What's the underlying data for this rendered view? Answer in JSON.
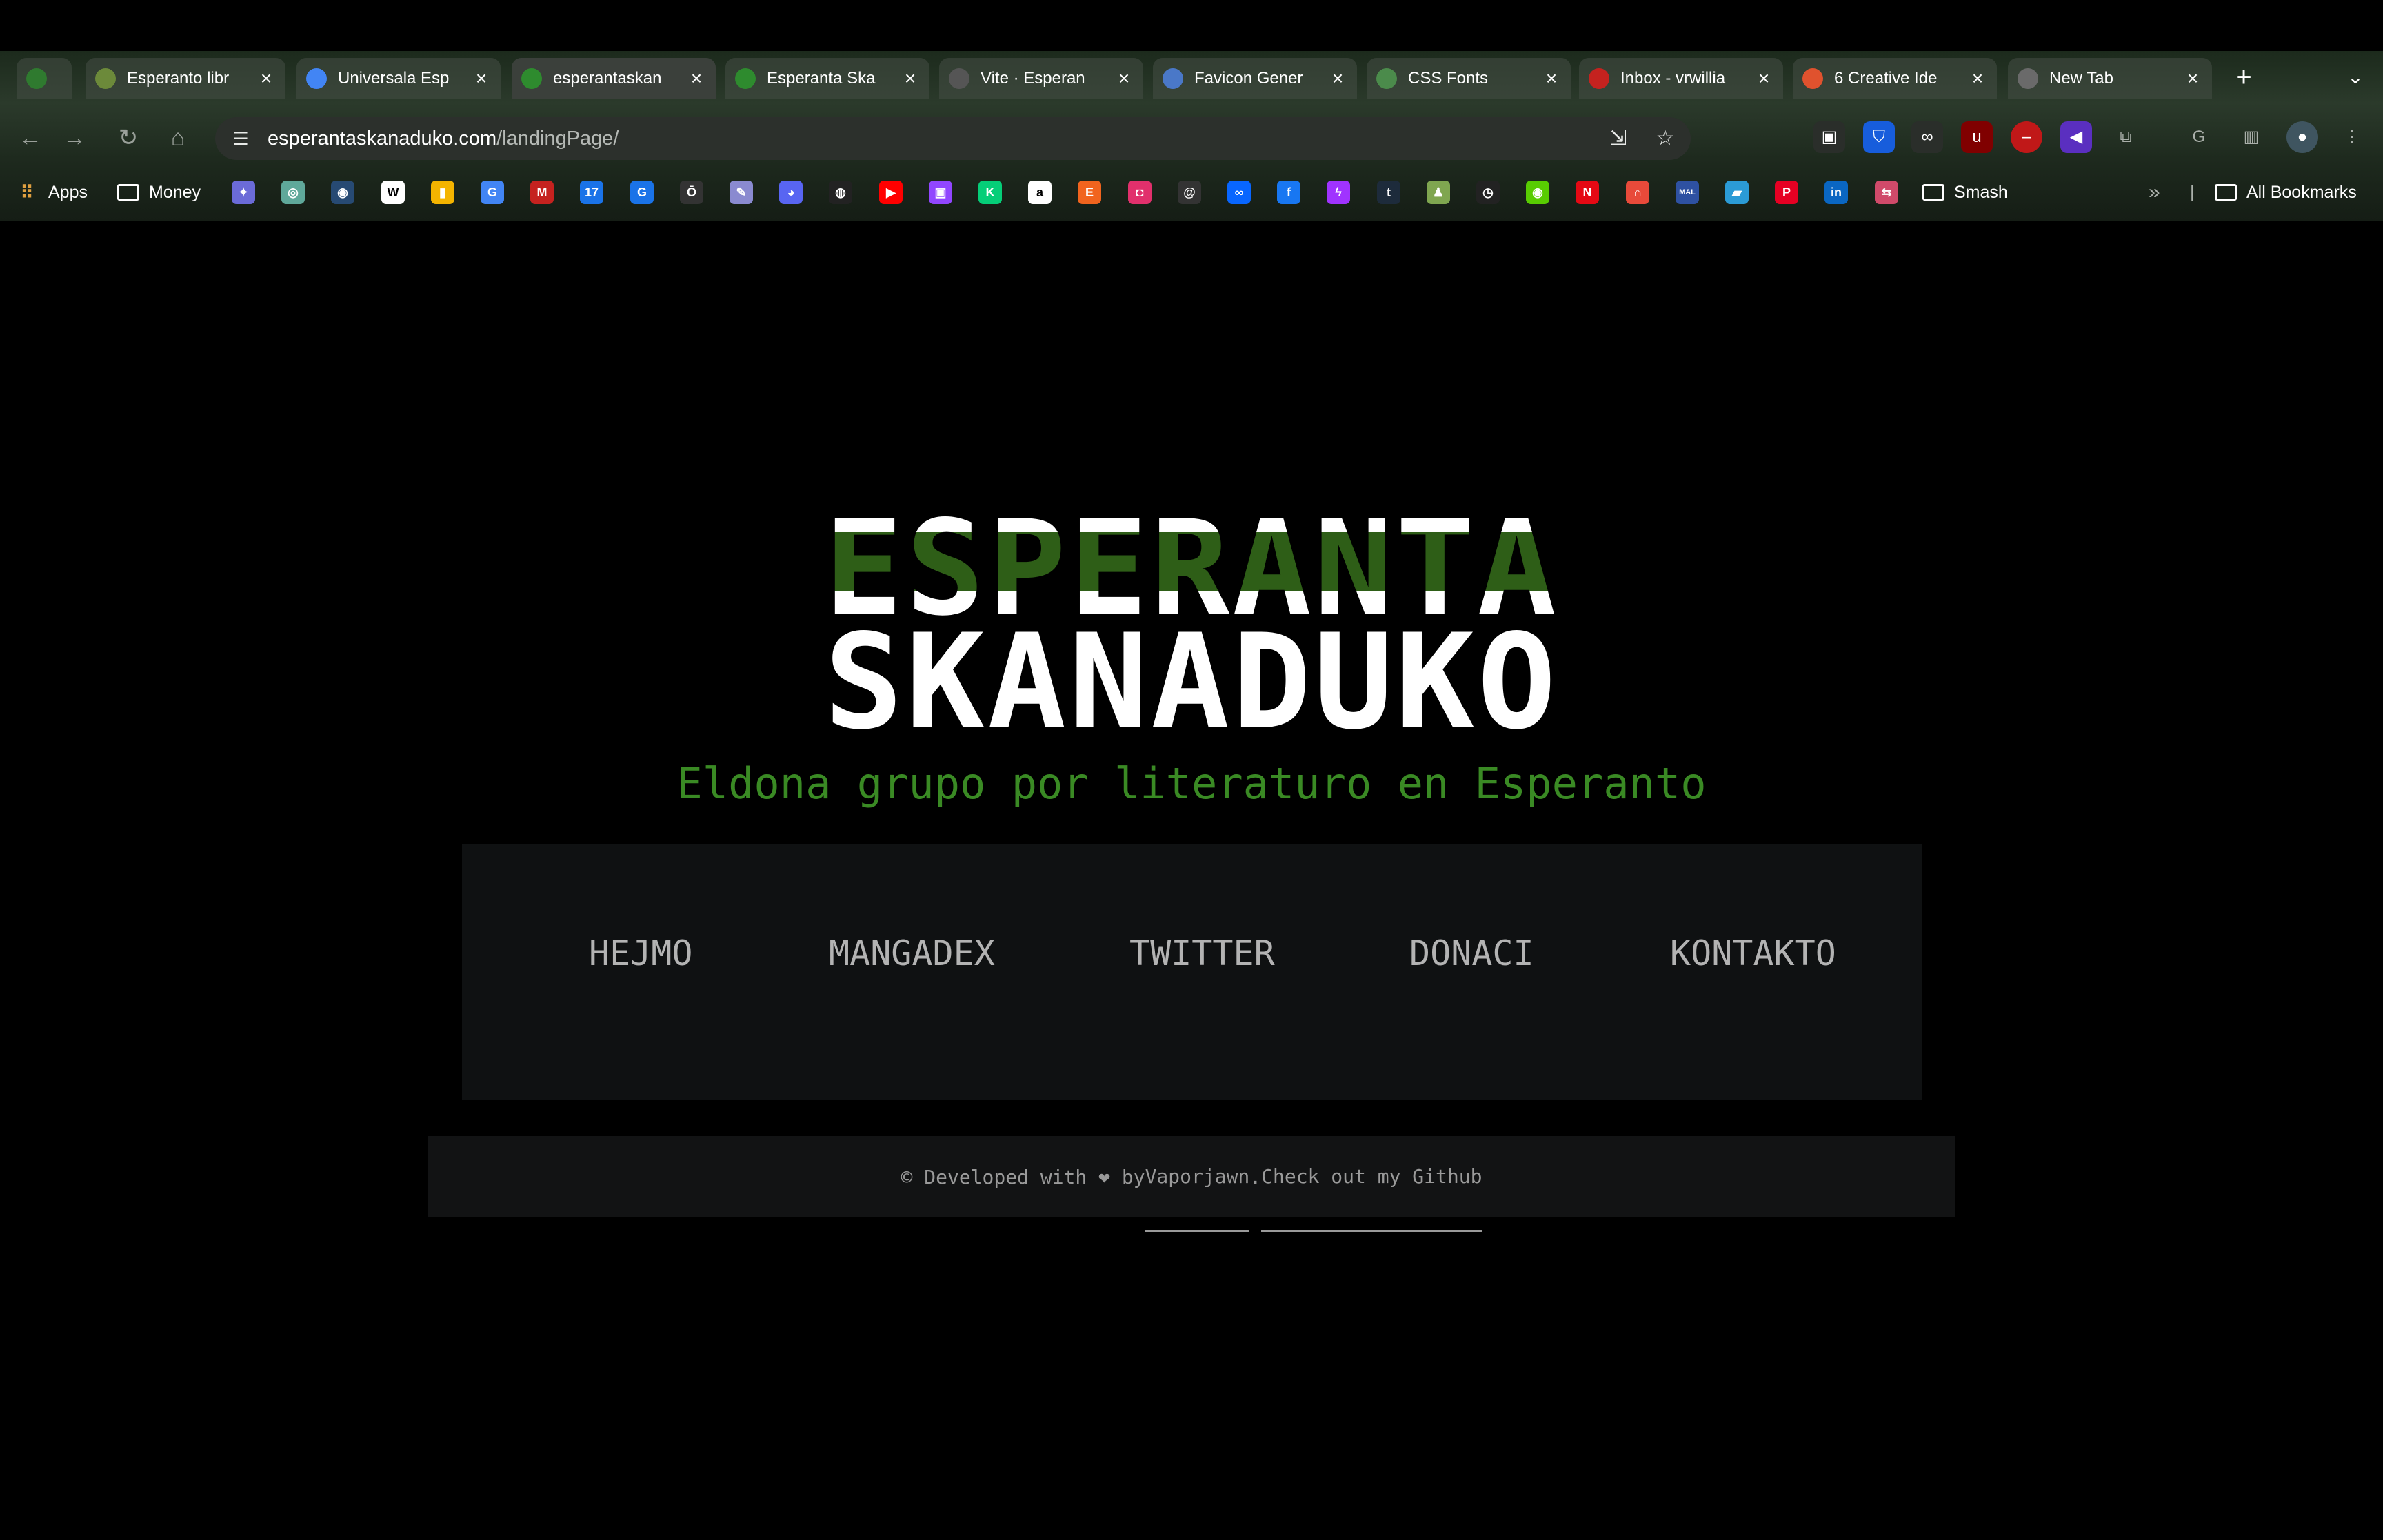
{
  "browser": {
    "tabs": [
      {
        "label": "",
        "icon": "grid-favicon-icon",
        "color": "#2f7a2f"
      },
      {
        "label": "Esperanto libr",
        "icon": "circle-favicon-icon",
        "color": "#6c8a3a"
      },
      {
        "label": "Universala Esp",
        "icon": "google-favicon-icon",
        "color": "#4285f4"
      },
      {
        "label": "esperantaskan",
        "icon": "esperanto-flag-icon",
        "color": "#2e8b2e"
      },
      {
        "label": "Esperanta Ska",
        "icon": "esperanto-flag-icon",
        "color": "#2e8b2e"
      },
      {
        "label": "Vite · Esperan",
        "icon": "github-favicon-icon",
        "color": "#555"
      },
      {
        "label": "Favicon Gener",
        "icon": "favicon-gen-icon",
        "color": "#4a78c8"
      },
      {
        "label": "CSS Fonts",
        "icon": "globe-favicon-icon",
        "color": "#4b8b4b"
      },
      {
        "label": "Inbox - vrwillia",
        "icon": "gmail-favicon-icon",
        "color": "#c5221f"
      },
      {
        "label": "6 Creative Ide",
        "icon": "star-favicon-icon",
        "color": "#e0522e"
      },
      {
        "label": "New Tab",
        "icon": "chrome-favicon-icon",
        "color": "#6a6a6a"
      }
    ],
    "address": {
      "host": "esperantaskanaduko.com",
      "path": "/landingPage/"
    },
    "bookmarks": {
      "apps_label": "Apps",
      "money_label": "Money",
      "smash_label": "Smash",
      "all_label": "All Bookmarks",
      "icons": [
        {
          "name": "gemini-icon",
          "glyph": "✦",
          "color": "#6b6bd8"
        },
        {
          "name": "chatgpt-icon",
          "glyph": "◎",
          "color": "#5fa89a"
        },
        {
          "name": "steam-icon",
          "glyph": "◉",
          "color": "#274a73"
        },
        {
          "name": "wikipedia-icon",
          "glyph": "W",
          "color": "#ffffff"
        },
        {
          "name": "keep-icon",
          "glyph": "▮",
          "color": "#f4b400"
        },
        {
          "name": "translate-icon",
          "glyph": "G",
          "color": "#4285f4"
        },
        {
          "name": "gmail-icon",
          "glyph": "M",
          "color": "#c5221f"
        },
        {
          "name": "calendar-icon",
          "glyph": "17",
          "color": "#1a73e8"
        },
        {
          "name": "slides-icon",
          "glyph": "G",
          "color": "#1a73e8"
        },
        {
          "name": "timer-icon",
          "glyph": "Ō",
          "color": "#333333"
        },
        {
          "name": "pencil-icon",
          "glyph": "✎",
          "color": "#8a8ad0"
        },
        {
          "name": "discord-icon",
          "glyph": "◕",
          "color": "#5865f2"
        },
        {
          "name": "github-icon",
          "glyph": "◍",
          "color": "#222222"
        },
        {
          "name": "youtube-icon",
          "glyph": "▶",
          "color": "#ff0000"
        },
        {
          "name": "twitch-icon",
          "glyph": "▣",
          "color": "#9146ff"
        },
        {
          "name": "kickstarter-icon",
          "glyph": "K",
          "color": "#05ce78"
        },
        {
          "name": "amazon-icon",
          "glyph": "a",
          "color": "#ffffff"
        },
        {
          "name": "etsy-icon",
          "glyph": "E",
          "color": "#f1641e"
        },
        {
          "name": "instagram-icon",
          "glyph": "◘",
          "color": "#e1306c"
        },
        {
          "name": "threads-icon",
          "glyph": "@",
          "color": "#333333"
        },
        {
          "name": "meta-icon",
          "glyph": "∞",
          "color": "#0866ff"
        },
        {
          "name": "facebook-icon",
          "glyph": "f",
          "color": "#1877f2"
        },
        {
          "name": "messenger-icon",
          "glyph": "ϟ",
          "color": "#a033ff"
        },
        {
          "name": "tumblr-icon",
          "glyph": "t",
          "color": "#1d2b3b"
        },
        {
          "name": "chess-icon",
          "glyph": "♟",
          "color": "#7fa650"
        },
        {
          "name": "clock-icon",
          "glyph": "◷",
          "color": "#222222"
        },
        {
          "name": "duolingo-icon",
          "glyph": "◉",
          "color": "#58cc02"
        },
        {
          "name": "netflix-icon",
          "glyph": "N",
          "color": "#e50914"
        },
        {
          "name": "shop-icon",
          "glyph": "⌂",
          "color": "#e84a3a"
        },
        {
          "name": "myanimelist-icon",
          "glyph": "MAL",
          "color": "#2e51a2"
        },
        {
          "name": "bar-icon",
          "glyph": "▰",
          "color": "#2b9bd6"
        },
        {
          "name": "pinterest-icon",
          "glyph": "P",
          "color": "#e60023"
        },
        {
          "name": "linkedin-icon",
          "glyph": "in",
          "color": "#0a66c2"
        },
        {
          "name": "link-icon",
          "glyph": "⇆",
          "color": "#d04a6a"
        }
      ]
    }
  },
  "page": {
    "logo_line1": "ESPERANTA",
    "logo_line2": "SKANADUKO",
    "tagline": "Eldona grupo por literaturo en Esperanto",
    "nav": [
      "HEJMO",
      "MANGADEX",
      "TWITTER",
      "DONACI",
      "KONTAKTO"
    ],
    "footer": {
      "prefix": "© Developed with ❤ by",
      "author": "Vaporjawn",
      "middle": ". ",
      "github": "Check out my Github"
    },
    "colors": {
      "accent_green": "#3a8a24",
      "logo_stripe": "#2e5e17",
      "nav_panel": "#0f1112"
    }
  }
}
